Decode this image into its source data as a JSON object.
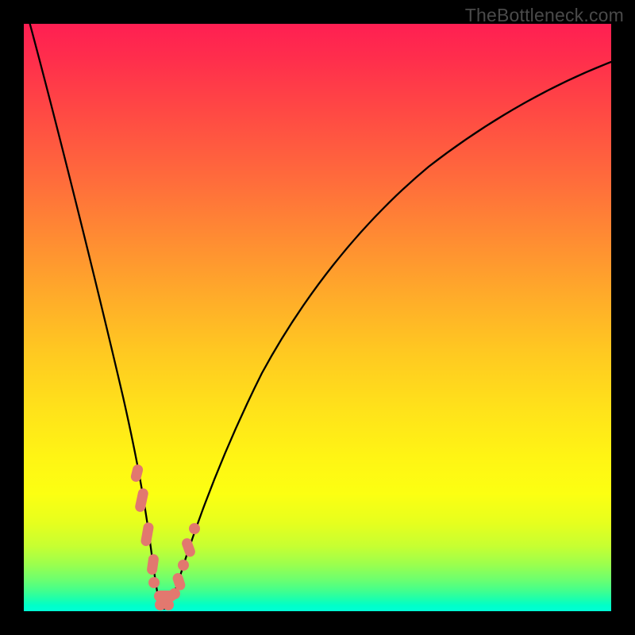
{
  "watermark": "TheBottleneck.com",
  "colors": {
    "frame": "#000000",
    "curve": "#000000",
    "markers": "#e2786f",
    "gradient_top": "#ff1f52",
    "gradient_bottom": "#00ffd6"
  },
  "chart_data": {
    "type": "line",
    "title": "",
    "xlabel": "",
    "ylabel": "",
    "xlim": [
      0,
      100
    ],
    "ylim": [
      0,
      100
    ],
    "grid": false,
    "legend": false,
    "annotations": [
      "TheBottleneck.com"
    ],
    "series": [
      {
        "name": "bottleneck-curve",
        "x": [
          0,
          2,
          4,
          6,
          8,
          10,
          12,
          14,
          16,
          18,
          19,
          20,
          21,
          22,
          23,
          24,
          25,
          26,
          28,
          30,
          33,
          36,
          40,
          45,
          50,
          56,
          63,
          71,
          80,
          90,
          100
        ],
        "y": [
          100,
          92,
          83,
          74,
          65,
          55,
          45,
          35,
          25,
          14,
          9,
          5,
          2,
          0.8,
          0.5,
          0.8,
          2,
          4,
          9,
          15,
          23,
          31,
          40,
          49,
          56,
          63,
          69,
          75,
          80,
          84,
          87
        ]
      }
    ],
    "highlighted_points": {
      "name": "sample-markers",
      "x": [
        17.8,
        18.4,
        19.2,
        19.9,
        20.6,
        21.4,
        22.3,
        23.3,
        24.7,
        25.5,
        26.3,
        27.3,
        28.5
      ],
      "y": [
        23,
        18,
        13,
        9,
        5.2,
        2.6,
        1.0,
        0.6,
        1.4,
        2.8,
        4.8,
        7.8,
        11.8
      ]
    }
  }
}
